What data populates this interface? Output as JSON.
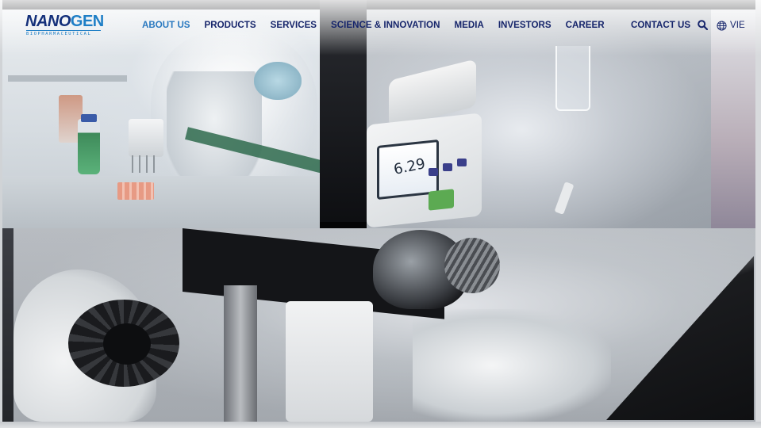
{
  "logo": {
    "name_part1": "NANO",
    "name_part2": "GEN",
    "tagline": "BIOPHARMACEUTICAL",
    "colors": {
      "primary": "#14307a",
      "accent": "#1f7fc6"
    }
  },
  "nav": {
    "items": [
      {
        "label": "ABOUT US",
        "active": true
      },
      {
        "label": "PRODUCTS",
        "active": false
      },
      {
        "label": "SERVICES",
        "active": false
      },
      {
        "label": "SCIENCE & INNOVATION",
        "active": false
      },
      {
        "label": "MEDIA",
        "active": false
      },
      {
        "label": "INVESTORS",
        "active": false
      },
      {
        "label": "CAREER",
        "active": false
      }
    ],
    "colors": {
      "text": "#16256b",
      "active": "#2a79c0"
    }
  },
  "header_right": {
    "contact_label": "CONTACT US",
    "search_icon": "search-icon",
    "globe_icon": "globe-icon",
    "language_label": "VIE"
  },
  "hero": {
    "photos": [
      {
        "subject": "lab-technicians-pipetting"
      },
      {
        "subject": "ph-meter-reading"
      },
      {
        "subject": "microscope-adjustment"
      }
    ],
    "meter_reading": "6.29"
  }
}
